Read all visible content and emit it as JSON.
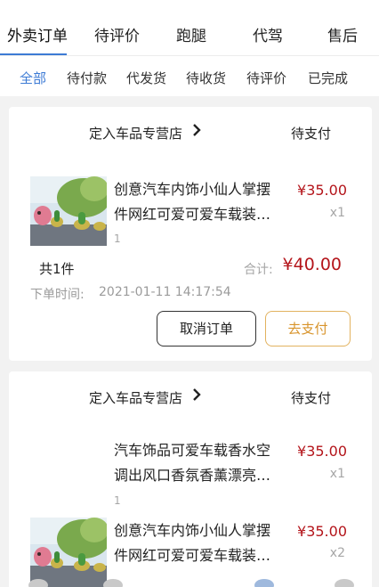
{
  "top_tabs": [
    "外卖订单",
    "待评价",
    "跑腿",
    "代驾",
    "售后"
  ],
  "sub_tabs": [
    "全部",
    "待付款",
    "代发货",
    "待收货",
    "待评价",
    "已完成"
  ],
  "orders": [
    {
      "store": "定入车品专营店",
      "status": "待支付",
      "items": [
        {
          "name_line1": "创意汽车内饰小仙人掌摆",
          "name_line2": "件网红可爱可爱车载装…",
          "price": "¥35.00",
          "qty": "x1",
          "spec": "1"
        }
      ],
      "count": "共1件",
      "total_label": "合计:",
      "total": "¥40.00",
      "time_label": "下单时间:",
      "time": "2021-01-11 14:17:54",
      "cancel_label": "取消订单",
      "pay_label": "去支付"
    },
    {
      "store": "定入车品专营店",
      "status": "待支付",
      "items": [
        {
          "name_line1": "汽车饰品可爱车载香水空",
          "name_line2": "调出风口香氛香薰漂亮…",
          "price": "¥35.00",
          "qty": "x1",
          "spec": "1"
        },
        {
          "name_line1": "创意汽车内饰小仙人掌摆",
          "name_line2": "件网红可爱可爱车载装…",
          "price": "¥35.00",
          "qty": "x2",
          "spec": ""
        }
      ]
    }
  ],
  "colors": {
    "accent": "#3d7bd5",
    "price": "#b4151b",
    "pay_border": "#e2b25f"
  },
  "icons": [
    "chevron-right-icon"
  ]
}
